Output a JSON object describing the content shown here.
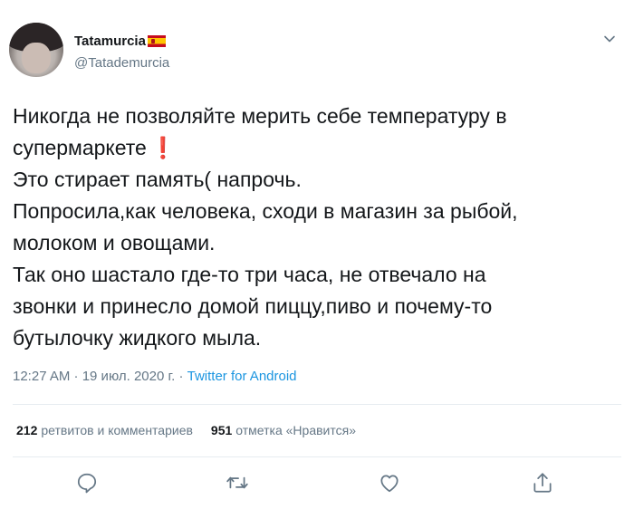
{
  "author": {
    "display_name": "Tatamurcia",
    "flag_icon": "spain-flag-icon",
    "handle": "@Tatademurcia"
  },
  "tweet": {
    "lines": [
      "Никогда не позволяйте мерить себе температуру в",
      "супермаркете",
      "Это стирает память( напрочь.",
      "Попросила,как человека, сходи в магазин за рыбой,",
      "молоком и овощами.",
      "Так оно шастало где-то три часа, не отвечало на",
      "звонки и принесло домой пиццу,пиво и почему-то",
      "бутылочку жидкого мыла."
    ],
    "emoji": "❗",
    "time": "12:27 AM · 19 июл. 2020 г. ·",
    "source": "Twitter for Android"
  },
  "stats": {
    "retweets_count": "212",
    "retweets_label": "ретвитов и комментариев",
    "likes_count": "951",
    "likes_label": "отметка «Нравится»"
  },
  "colors": {
    "text": "#14171a",
    "secondary": "#657786",
    "link": "#1b95e0",
    "divider": "#e6ecf0"
  },
  "icons": [
    "chevron-down-icon",
    "reply-icon",
    "retweet-icon",
    "like-icon",
    "share-icon"
  ]
}
